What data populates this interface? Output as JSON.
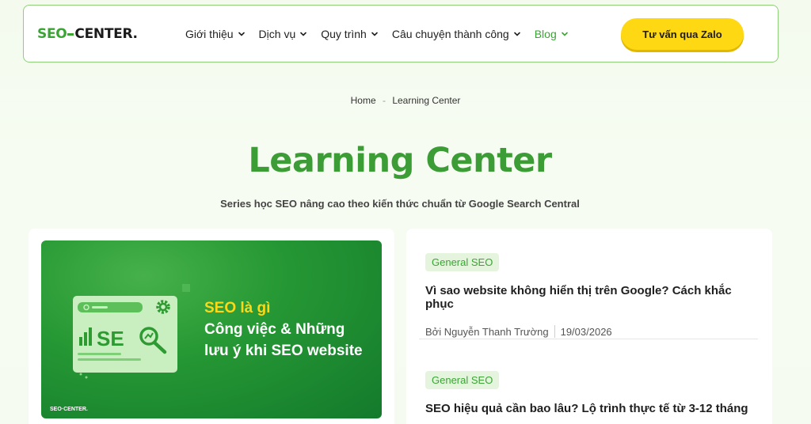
{
  "header": {
    "logo": {
      "part1": "SEO",
      "part2": "CENTER."
    },
    "nav": [
      {
        "label": "Giới thiệu",
        "active": false
      },
      {
        "label": "Dịch vụ",
        "active": false
      },
      {
        "label": "Quy trình",
        "active": false
      },
      {
        "label": "Câu chuyện thành công",
        "active": false
      },
      {
        "label": "Blog",
        "active": true
      }
    ],
    "cta_label": "Tư vấn qua Zalo"
  },
  "breadcrumb": {
    "home": "Home",
    "separator": "-",
    "current": "Learning Center"
  },
  "page": {
    "title": "Learning Center",
    "subtitle": "Series học SEO nâng cao theo kiến thức chuẩn từ Google Search Central"
  },
  "featured": {
    "line1": "SEO là gì",
    "line2": "Công việc & Những",
    "line3": "lưu ý khi SEO website",
    "illus_text": "SE",
    "logo": "SEO·CENTER."
  },
  "posts": [
    {
      "tag": "General SEO",
      "title": "Vì sao website không hiển thị trên Google? Cách khắc phục",
      "author": "Bởi Nguyễn Thanh Trường",
      "date": "19/03/2026"
    },
    {
      "tag": "General SEO",
      "title": "SEO hiệu quả cần bao lâu? Lộ trình thực tế từ 3-12 tháng"
    }
  ],
  "colors": {
    "brand_green": "#3aa534",
    "cta_yellow": "#ffd814",
    "title_green": "#3c9c35"
  }
}
